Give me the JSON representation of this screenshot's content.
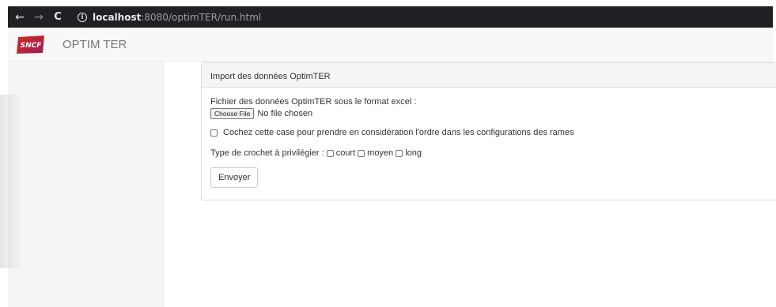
{
  "browser": {
    "back_icon": "←",
    "forward_icon": "→",
    "reload_icon": "C",
    "info_icon": "i",
    "url_host": "localhost",
    "url_rest": ":8080/optimTER/run.html"
  },
  "header": {
    "logo_text": "SNCF",
    "app_title": "OPTIM TER"
  },
  "panel": {
    "heading": "Import des données OptimTER",
    "file_label": "Fichier des données OptimTER sous le format excel :",
    "choose_file_label": "Choose File",
    "no_file_text": "No file chosen",
    "order_checkbox_label": "Cochez cette case pour prendre en considération l'ordre dans les configurations des rames",
    "crochet_label": "Type de crochet à privilégier :",
    "crochet_options": [
      "court",
      "moyen",
      "long"
    ],
    "submit_label": "Envoyer"
  },
  "colors": {
    "browser_bar": "#202124",
    "header_bg": "#f8f8f8",
    "sidebar_bg": "#f5f5f5",
    "logo_red": "#d52b1e",
    "logo_purple": "#9b1d5a"
  }
}
